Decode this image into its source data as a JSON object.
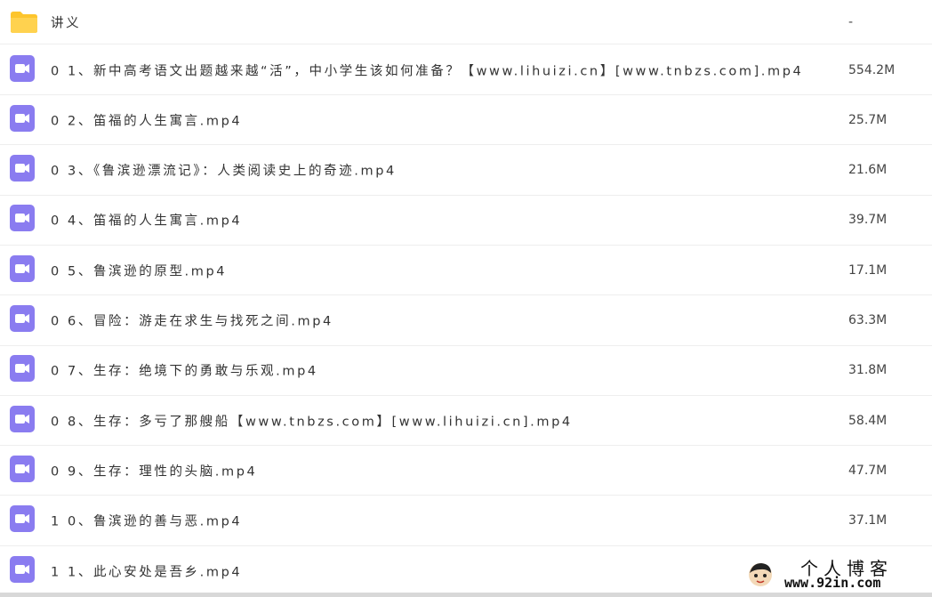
{
  "folder": {
    "name": "讲义",
    "size": "-"
  },
  "files": [
    {
      "name": "0 1、新中高考语文出题越来越“活”，中小学生该如何准备？【www.lihuizi.cn】[www.tnbzs.com].mp4",
      "size": "554.2M"
    },
    {
      "name": "0 2、笛福的人生寓言.mp4",
      "size": "25.7M"
    },
    {
      "name": "0 3、《鲁滨逊漂流记》：人类阅读史上的奇迹.mp4",
      "size": "21.6M"
    },
    {
      "name": "0 4、笛福的人生寓言.mp4",
      "size": "39.7M"
    },
    {
      "name": "0 5、鲁滨逊的原型.mp4",
      "size": "17.1M"
    },
    {
      "name": "0 6、冒险：游走在求生与找死之间.mp4",
      "size": "63.3M"
    },
    {
      "name": "0 7、生存：绝境下的勇敢与乐观.mp4",
      "size": "31.8M"
    },
    {
      "name": "0 8、生存：多亏了那艘船【www.tnbzs.com】[www.lihuizi.cn].mp4",
      "size": "58.4M"
    },
    {
      "name": "0 9、生存：理性的头脑.mp4",
      "size": "47.7M"
    },
    {
      "name": "1 0、鲁滨逊的善与恶.mp4",
      "size": "37.1M"
    },
    {
      "name": "1 1、此心安处是吾乡.mp4",
      "size": ""
    }
  ],
  "icons": {
    "folder": "folder-icon",
    "video": "video-file-icon"
  },
  "colors": {
    "folder": "#fdc52d",
    "video": "#8a7cf0"
  },
  "watermark": {
    "title": "个人博客",
    "url": "www.92in.com"
  }
}
